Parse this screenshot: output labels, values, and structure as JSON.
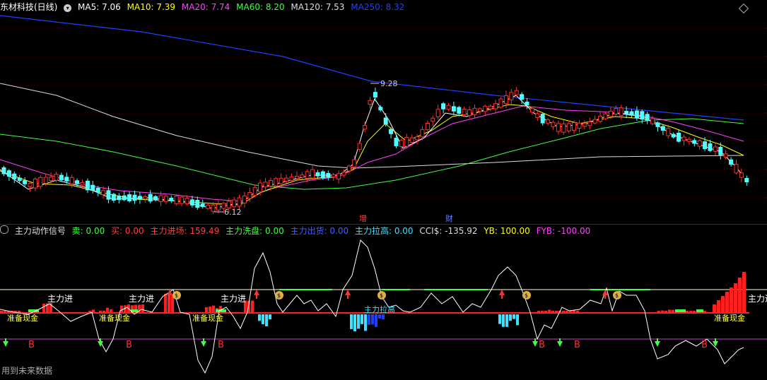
{
  "main_header": {
    "title": "东材科技(日线)",
    "ma": [
      {
        "label": "MA5: 7.06",
        "color": "#ffffff"
      },
      {
        "label": "MA10: 7.39",
        "color": "#ffff00"
      },
      {
        "label": "MA20: 7.74",
        "color": "#ff40ff"
      },
      {
        "label": "MA60: 8.20",
        "color": "#40ff40"
      },
      {
        "label": "MA120: 7.53",
        "color": "#dcdcdc"
      },
      {
        "label": "MA250: 8.32",
        "color": "#2040ff"
      }
    ]
  },
  "price_annotations": {
    "high": "9.28",
    "low": "6.12",
    "mark1": "增",
    "mark2": "财"
  },
  "indicator_header": {
    "title": "主力动作信号",
    "items": [
      {
        "label": "卖: 0.00",
        "color": "#40ff40"
      },
      {
        "label": "买: 0.00",
        "color": "#ff4040"
      },
      {
        "label": "主力进场: 159.49",
        "color": "#ff4040"
      },
      {
        "label": "主力洗盘: 0.00",
        "color": "#40ff40"
      },
      {
        "label": "主力出货: 0.00",
        "color": "#4060ff"
      },
      {
        "label": "主力拉高: 0.00",
        "color": "#40e0ff"
      },
      {
        "label": "CCI$: -135.92",
        "color": "#dcdcdc"
      },
      {
        "label": "YB: 100.00",
        "color": "#ffff00"
      },
      {
        "label": "FYB: -100.00",
        "color": "#ff40ff"
      }
    ]
  },
  "indicator_labels": {
    "enter": "主力进",
    "enter_cut": "主力进",
    "ready": "准备现金",
    "lift": "主力拉高",
    "buy": "B",
    "footer": "用到未来数据"
  },
  "colors": {
    "up": "#ff3030",
    "down": "#54ffff",
    "ma5": "#ffffff",
    "ma10": "#ffff00",
    "ma20": "#ff40ff",
    "ma60": "#40ff40",
    "ma120": "#dcdcdc",
    "ma250": "#2040ff"
  }
}
